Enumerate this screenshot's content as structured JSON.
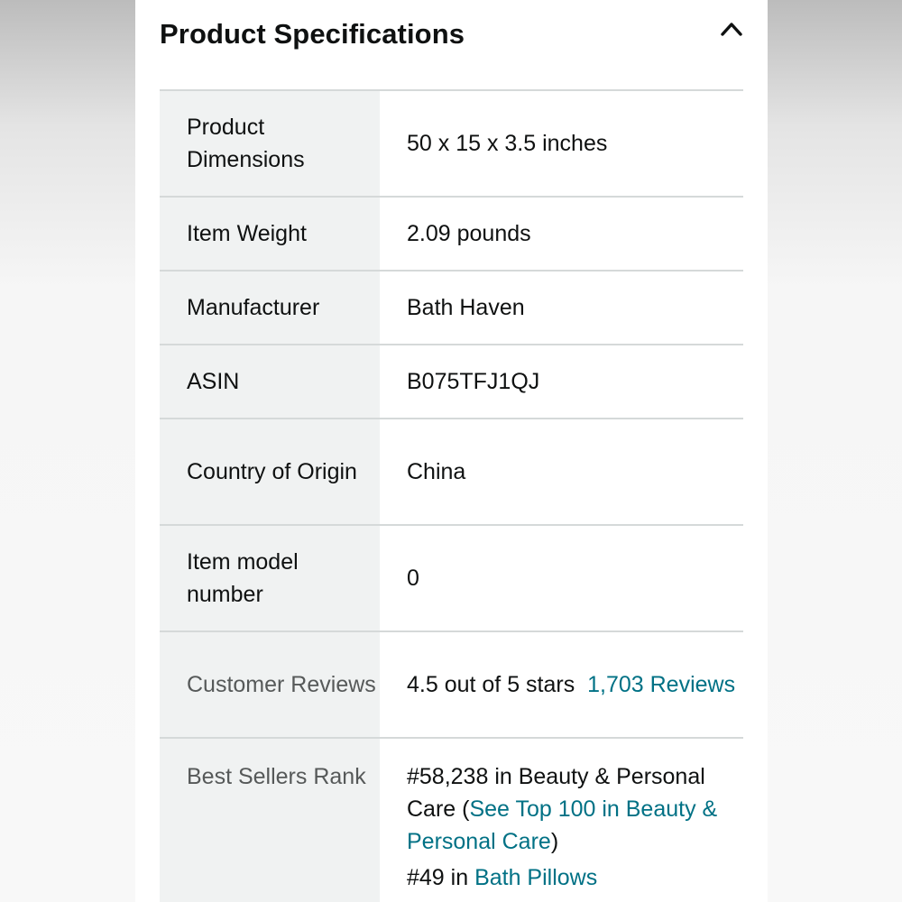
{
  "section": {
    "title": "Product Specifications",
    "collapse_icon": "chevron-up-icon"
  },
  "specs": {
    "dimensions_label": "Product Dimensions",
    "dimensions_value": "50 x 15 x 3.5 inches",
    "weight_label": "Item Weight",
    "weight_value": "2.09 pounds",
    "manufacturer_label": "Manufacturer",
    "manufacturer_value": "Bath Haven",
    "asin_label": "ASIN",
    "asin_value": "B075TFJ1QJ",
    "origin_label": "Country of Origin",
    "origin_value": "China",
    "model_label": "Item model number",
    "model_value": "0",
    "reviews_label": "Customer Reviews",
    "reviews_rating": "4.5 out of 5 stars",
    "reviews_link": "1,703 Reviews",
    "rank_label": "Best Sellers Rank",
    "rank_1_text": "#58,238 in Beauty & Personal Care (",
    "rank_1_link": "See Top 100 in Beauty & Personal Care",
    "rank_1_close": ")",
    "rank_2_text": "#49 in ",
    "rank_2_link": "Bath Pillows"
  },
  "colors": {
    "label_bg": "#f0f2f2",
    "link": "#007185",
    "divider": "#d5d9d9"
  }
}
